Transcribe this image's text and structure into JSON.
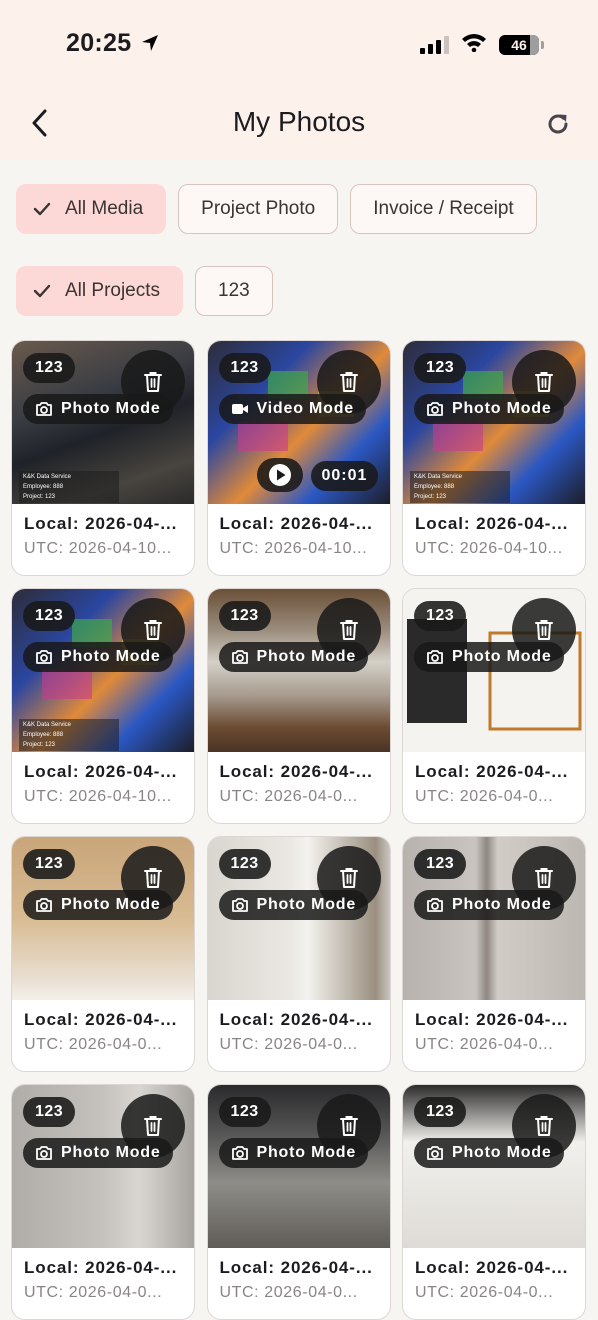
{
  "status_bar": {
    "time": "20:25",
    "battery": "46"
  },
  "header": {
    "title": "My Photos"
  },
  "filters": {
    "media": [
      {
        "label": "All Media",
        "selected": true
      },
      {
        "label": "Project Photo",
        "selected": false
      },
      {
        "label": "Invoice / Receipt",
        "selected": false
      }
    ],
    "projects": [
      {
        "label": "All Projects",
        "selected": true
      },
      {
        "label": "123",
        "selected": false
      }
    ]
  },
  "photos": [
    {
      "project": "123",
      "mode": "Photo Mode",
      "local": "Local: 2026-04-...",
      "utc": "UTC: 2026-04-10...",
      "watermark": [
        "K&K Data Service",
        "Employee: 888",
        "Project: 123"
      ]
    },
    {
      "project": "123",
      "mode": "Video Mode",
      "duration": "00:01",
      "local": "Local: 2026-04-...",
      "utc": "UTC: 2026-04-10..."
    },
    {
      "project": "123",
      "mode": "Photo Mode",
      "local": "Local: 2026-04-...",
      "utc": "UTC: 2026-04-10...",
      "watermark": [
        "K&K Data Service",
        "Employee: 888",
        "Project: 123"
      ]
    },
    {
      "project": "123",
      "mode": "Photo Mode",
      "local": "Local: 2026-04-...",
      "utc": "UTC: 2026-04-10...",
      "watermark": [
        "K&K Data Service",
        "Employee: 888",
        "Project: 123"
      ]
    },
    {
      "project": "123",
      "mode": "Photo Mode",
      "local": "Local: 2026-04-...",
      "utc": "UTC: 2026-04-0..."
    },
    {
      "project": "123",
      "mode": "Photo Mode",
      "local": "Local: 2026-04-...",
      "utc": "UTC: 2026-04-0..."
    },
    {
      "project": "123",
      "mode": "Photo Mode",
      "local": "Local: 2026-04-...",
      "utc": "UTC: 2026-04-0..."
    },
    {
      "project": "123",
      "mode": "Photo Mode",
      "local": "Local: 2026-04-...",
      "utc": "UTC: 2026-04-0..."
    },
    {
      "project": "123",
      "mode": "Photo Mode",
      "local": "Local: 2026-04-...",
      "utc": "UTC: 2026-04-0..."
    },
    {
      "project": "123",
      "mode": "Photo Mode",
      "local": "Local: 2026-04-...",
      "utc": "UTC: 2026-04-0..."
    },
    {
      "project": "123",
      "mode": "Photo Mode",
      "local": "Local: 2026-04-...",
      "utc": "UTC: 2026-04-0..."
    },
    {
      "project": "123",
      "mode": "Photo Mode",
      "local": "Local: 2026-04-...",
      "utc": "UTC: 2026-04-0..."
    }
  ],
  "icons": {
    "back": "chevron-left-icon",
    "refresh": "refresh-icon",
    "check": "check-icon",
    "delete": "trash-icon",
    "photo_mode": "camera-icon",
    "video_mode": "video-camera-icon",
    "play": "play-icon"
  },
  "colors": {
    "header_bg": "#fdf1ec",
    "page_bg": "#f7f5f2",
    "chip_selected": "#fcd9d6",
    "overlay": "#191919"
  }
}
